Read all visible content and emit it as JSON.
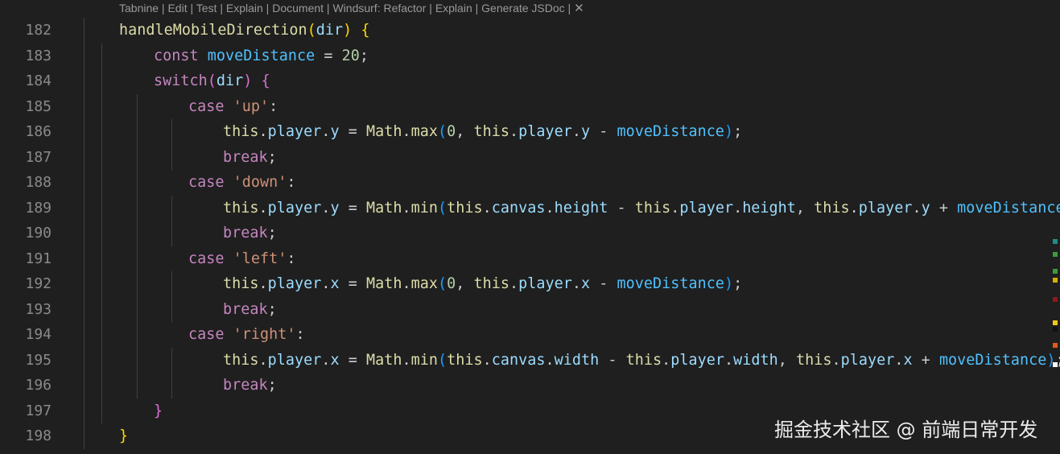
{
  "codelens": {
    "items": [
      "Tabnine",
      "Edit",
      "Test",
      "Explain",
      "Document",
      "Windsurf: Refactor",
      "Explain",
      "Generate JSDoc"
    ],
    "close_glyph": "✕"
  },
  "colors": {
    "background": "#1f1f1f",
    "default": "#cccccc",
    "keyword": "#c586c0",
    "function": "#dcdcaa",
    "variable": "#9cdcfe",
    "constant": "#4fc1ff",
    "string": "#ce9178",
    "number": "#b5cea8",
    "bracket1": "#ffd700",
    "bracket2": "#da70d6",
    "bracket3": "#179fff"
  },
  "editor": {
    "lines": [
      {
        "number": "182",
        "indent": 1,
        "tokens": [
          {
            "t": "handleMobileDirection",
            "c": "function"
          },
          {
            "t": "(",
            "c": "bracket1"
          },
          {
            "t": "dir",
            "c": "variable"
          },
          {
            "t": ")",
            "c": "bracket1"
          },
          {
            "t": " ",
            "c": "default"
          },
          {
            "t": "{",
            "c": "bracket1"
          }
        ]
      },
      {
        "number": "183",
        "indent": 2,
        "tokens": [
          {
            "t": "const",
            "c": "keyword"
          },
          {
            "t": " ",
            "c": "default"
          },
          {
            "t": "moveDistance",
            "c": "constant"
          },
          {
            "t": " = ",
            "c": "default"
          },
          {
            "t": "20",
            "c": "number"
          },
          {
            "t": ";",
            "c": "default"
          }
        ]
      },
      {
        "number": "184",
        "indent": 2,
        "tokens": [
          {
            "t": "switch",
            "c": "keyword"
          },
          {
            "t": "(",
            "c": "bracket2"
          },
          {
            "t": "dir",
            "c": "variable"
          },
          {
            "t": ")",
            "c": "bracket2"
          },
          {
            "t": " ",
            "c": "default"
          },
          {
            "t": "{",
            "c": "bracket2"
          }
        ]
      },
      {
        "number": "185",
        "indent": 3,
        "tokens": [
          {
            "t": "case",
            "c": "keyword"
          },
          {
            "t": " ",
            "c": "default"
          },
          {
            "t": "'up'",
            "c": "string"
          },
          {
            "t": ":",
            "c": "default"
          }
        ]
      },
      {
        "number": "186",
        "indent": 4,
        "tokens": [
          {
            "t": "this",
            "c": "function"
          },
          {
            "t": ".",
            "c": "default"
          },
          {
            "t": "player",
            "c": "variable"
          },
          {
            "t": ".",
            "c": "default"
          },
          {
            "t": "y",
            "c": "variable"
          },
          {
            "t": " = ",
            "c": "default"
          },
          {
            "t": "Math",
            "c": "function"
          },
          {
            "t": ".",
            "c": "default"
          },
          {
            "t": "max",
            "c": "function"
          },
          {
            "t": "(",
            "c": "bracket3"
          },
          {
            "t": "0",
            "c": "number"
          },
          {
            "t": ", ",
            "c": "default"
          },
          {
            "t": "this",
            "c": "function"
          },
          {
            "t": ".",
            "c": "default"
          },
          {
            "t": "player",
            "c": "variable"
          },
          {
            "t": ".",
            "c": "default"
          },
          {
            "t": "y",
            "c": "variable"
          },
          {
            "t": " - ",
            "c": "default"
          },
          {
            "t": "moveDistance",
            "c": "constant"
          },
          {
            "t": ")",
            "c": "bracket3"
          },
          {
            "t": ";",
            "c": "default"
          }
        ]
      },
      {
        "number": "187",
        "indent": 4,
        "tokens": [
          {
            "t": "break",
            "c": "keyword"
          },
          {
            "t": ";",
            "c": "default"
          }
        ]
      },
      {
        "number": "188",
        "indent": 3,
        "tokens": [
          {
            "t": "case",
            "c": "keyword"
          },
          {
            "t": " ",
            "c": "default"
          },
          {
            "t": "'down'",
            "c": "string"
          },
          {
            "t": ":",
            "c": "default"
          }
        ]
      },
      {
        "number": "189",
        "indent": 4,
        "tokens": [
          {
            "t": "this",
            "c": "function"
          },
          {
            "t": ".",
            "c": "default"
          },
          {
            "t": "player",
            "c": "variable"
          },
          {
            "t": ".",
            "c": "default"
          },
          {
            "t": "y",
            "c": "variable"
          },
          {
            "t": " = ",
            "c": "default"
          },
          {
            "t": "Math",
            "c": "function"
          },
          {
            "t": ".",
            "c": "default"
          },
          {
            "t": "min",
            "c": "function"
          },
          {
            "t": "(",
            "c": "bracket3"
          },
          {
            "t": "this",
            "c": "function"
          },
          {
            "t": ".",
            "c": "default"
          },
          {
            "t": "canvas",
            "c": "variable"
          },
          {
            "t": ".",
            "c": "default"
          },
          {
            "t": "height",
            "c": "variable"
          },
          {
            "t": " - ",
            "c": "default"
          },
          {
            "t": "this",
            "c": "function"
          },
          {
            "t": ".",
            "c": "default"
          },
          {
            "t": "player",
            "c": "variable"
          },
          {
            "t": ".",
            "c": "default"
          },
          {
            "t": "height",
            "c": "variable"
          },
          {
            "t": ", ",
            "c": "default"
          },
          {
            "t": "this",
            "c": "function"
          },
          {
            "t": ".",
            "c": "default"
          },
          {
            "t": "player",
            "c": "variable"
          },
          {
            "t": ".",
            "c": "default"
          },
          {
            "t": "y",
            "c": "variable"
          },
          {
            "t": " + ",
            "c": "default"
          },
          {
            "t": "moveDistance",
            "c": "constant"
          },
          {
            "t": ")",
            "c": "bracket3"
          },
          {
            "t": ";",
            "c": "default"
          }
        ]
      },
      {
        "number": "190",
        "indent": 4,
        "tokens": [
          {
            "t": "break",
            "c": "keyword"
          },
          {
            "t": ";",
            "c": "default"
          }
        ]
      },
      {
        "number": "191",
        "indent": 3,
        "tokens": [
          {
            "t": "case",
            "c": "keyword"
          },
          {
            "t": " ",
            "c": "default"
          },
          {
            "t": "'left'",
            "c": "string"
          },
          {
            "t": ":",
            "c": "default"
          }
        ]
      },
      {
        "number": "192",
        "indent": 4,
        "tokens": [
          {
            "t": "this",
            "c": "function"
          },
          {
            "t": ".",
            "c": "default"
          },
          {
            "t": "player",
            "c": "variable"
          },
          {
            "t": ".",
            "c": "default"
          },
          {
            "t": "x",
            "c": "variable"
          },
          {
            "t": " = ",
            "c": "default"
          },
          {
            "t": "Math",
            "c": "function"
          },
          {
            "t": ".",
            "c": "default"
          },
          {
            "t": "max",
            "c": "function"
          },
          {
            "t": "(",
            "c": "bracket3"
          },
          {
            "t": "0",
            "c": "number"
          },
          {
            "t": ", ",
            "c": "default"
          },
          {
            "t": "this",
            "c": "function"
          },
          {
            "t": ".",
            "c": "default"
          },
          {
            "t": "player",
            "c": "variable"
          },
          {
            "t": ".",
            "c": "default"
          },
          {
            "t": "x",
            "c": "variable"
          },
          {
            "t": " - ",
            "c": "default"
          },
          {
            "t": "moveDistance",
            "c": "constant"
          },
          {
            "t": ")",
            "c": "bracket3"
          },
          {
            "t": ";",
            "c": "default"
          }
        ]
      },
      {
        "number": "193",
        "indent": 4,
        "tokens": [
          {
            "t": "break",
            "c": "keyword"
          },
          {
            "t": ";",
            "c": "default"
          }
        ]
      },
      {
        "number": "194",
        "indent": 3,
        "tokens": [
          {
            "t": "case",
            "c": "keyword"
          },
          {
            "t": " ",
            "c": "default"
          },
          {
            "t": "'right'",
            "c": "string"
          },
          {
            "t": ":",
            "c": "default"
          }
        ]
      },
      {
        "number": "195",
        "indent": 4,
        "tokens": [
          {
            "t": "this",
            "c": "function"
          },
          {
            "t": ".",
            "c": "default"
          },
          {
            "t": "player",
            "c": "variable"
          },
          {
            "t": ".",
            "c": "default"
          },
          {
            "t": "x",
            "c": "variable"
          },
          {
            "t": " = ",
            "c": "default"
          },
          {
            "t": "Math",
            "c": "function"
          },
          {
            "t": ".",
            "c": "default"
          },
          {
            "t": "min",
            "c": "function"
          },
          {
            "t": "(",
            "c": "bracket3"
          },
          {
            "t": "this",
            "c": "function"
          },
          {
            "t": ".",
            "c": "default"
          },
          {
            "t": "canvas",
            "c": "variable"
          },
          {
            "t": ".",
            "c": "default"
          },
          {
            "t": "width",
            "c": "variable"
          },
          {
            "t": " - ",
            "c": "default"
          },
          {
            "t": "this",
            "c": "function"
          },
          {
            "t": ".",
            "c": "default"
          },
          {
            "t": "player",
            "c": "variable"
          },
          {
            "t": ".",
            "c": "default"
          },
          {
            "t": "width",
            "c": "variable"
          },
          {
            "t": ", ",
            "c": "default"
          },
          {
            "t": "this",
            "c": "function"
          },
          {
            "t": ".",
            "c": "default"
          },
          {
            "t": "player",
            "c": "variable"
          },
          {
            "t": ".",
            "c": "default"
          },
          {
            "t": "x",
            "c": "variable"
          },
          {
            "t": " + ",
            "c": "default"
          },
          {
            "t": "moveDistance",
            "c": "constant"
          },
          {
            "t": ")",
            "c": "bracket3"
          },
          {
            "t": ";",
            "c": "default"
          }
        ]
      },
      {
        "number": "196",
        "indent": 4,
        "tokens": [
          {
            "t": "break",
            "c": "keyword"
          },
          {
            "t": ";",
            "c": "default"
          }
        ]
      },
      {
        "number": "197",
        "indent": 2,
        "tokens": [
          {
            "t": "}",
            "c": "bracket2"
          }
        ]
      },
      {
        "number": "198",
        "indent": 1,
        "tokens": [
          {
            "t": "}",
            "c": "bracket1"
          }
        ]
      }
    ]
  },
  "scrollbar_marks": [
    "#1e8c8c",
    "#3c9b3c",
    "#3c9b3c",
    "#d4b106",
    "#8b1a1a",
    "#f5c518",
    "#111111",
    "#e05a1e",
    "#ffffff"
  ],
  "watermark": "掘金技术社区 @ 前端日常开发"
}
